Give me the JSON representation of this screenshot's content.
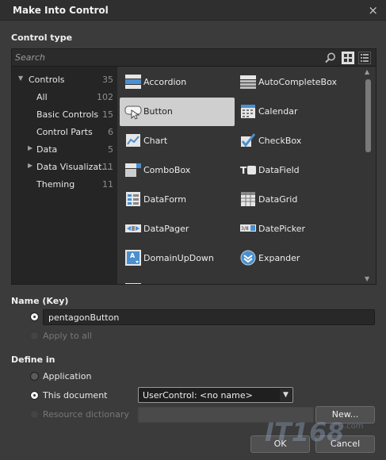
{
  "window": {
    "title": "Make Into Control",
    "close_glyph": "×"
  },
  "control_type": {
    "label": "Control type",
    "search": {
      "placeholder": "Search",
      "icon": "magnifier-icon"
    },
    "views": {
      "grid": "grid-view-icon",
      "list": "list-view-icon"
    },
    "tree": [
      {
        "label": "Controls",
        "count": "35",
        "expanded": true,
        "indent": 0
      },
      {
        "label": "All",
        "count": "102",
        "indent": 1
      },
      {
        "label": "Basic Controls",
        "count": "15",
        "indent": 1
      },
      {
        "label": "Control Parts",
        "count": "6",
        "indent": 1
      },
      {
        "label": "Data",
        "count": "5",
        "collapsed": true,
        "indent": 0
      },
      {
        "label": "Data Visualizat...",
        "count": "11",
        "collapsed": true,
        "indent": 0
      },
      {
        "label": "Theming",
        "count": "11",
        "indent": 1
      }
    ],
    "items": [
      {
        "label": "Accordion",
        "icon": "accordion-icon"
      },
      {
        "label": "AutoCompleteBox",
        "icon": "autocompletebox-icon"
      },
      {
        "label": "Button",
        "icon": "button-icon",
        "selected": true
      },
      {
        "label": "Calendar",
        "icon": "calendar-icon"
      },
      {
        "label": "Chart",
        "icon": "chart-icon"
      },
      {
        "label": "CheckBox",
        "icon": "checkbox-icon"
      },
      {
        "label": "ComboBox",
        "icon": "combobox-icon"
      },
      {
        "label": "DataField",
        "icon": "datafield-icon"
      },
      {
        "label": "DataForm",
        "icon": "dataform-icon"
      },
      {
        "label": "DataGrid",
        "icon": "datagrid-icon"
      },
      {
        "label": "DataPager",
        "icon": "datapager-icon"
      },
      {
        "label": "DatePicker",
        "icon": "datepicker-icon"
      },
      {
        "label": "DomainUpDown",
        "icon": "domainupdown-icon"
      },
      {
        "label": "Expander",
        "icon": "expander-icon"
      }
    ]
  },
  "name_key": {
    "label": "Name (Key)",
    "value": "pentagonButton",
    "apply_to_all": "Apply to all"
  },
  "define_in": {
    "label": "Define in",
    "application": "Application",
    "this_document": "This document",
    "document_value": "UserControl: <no name>",
    "resource_dictionary": "Resource dictionary",
    "new_button": "New..."
  },
  "buttons": {
    "ok": "OK",
    "cancel": "Cancel"
  },
  "watermark": {
    "text": "IT168",
    "suffix": ".com"
  }
}
